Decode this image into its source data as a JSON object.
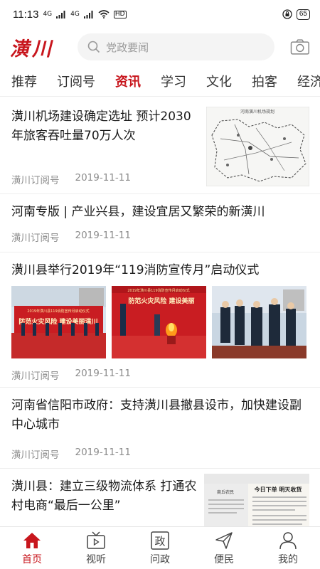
{
  "status_bar": {
    "time": "11:13",
    "network": "4G",
    "network_secondary": "4G",
    "hd_label": "HD",
    "battery": "65"
  },
  "header": {
    "logo": "潢川",
    "search_placeholder": "党政要闻"
  },
  "tabs": [
    {
      "label": "推荐"
    },
    {
      "label": "订阅号"
    },
    {
      "label": "资讯"
    },
    {
      "label": "学习"
    },
    {
      "label": "文化"
    },
    {
      "label": "拍客"
    },
    {
      "label": "经济"
    }
  ],
  "active_tab": "资讯",
  "articles": [
    {
      "title": "潢川机场建设确定选址 预计2030年旅客吞吐量70万人次",
      "source": "潢川订阅号",
      "date": "2019-11-11",
      "thumb_title": "河南潢川机场规划"
    },
    {
      "title": "河南专版 | 产业兴县，建设宜居又繁荣的新潢川",
      "source": "潢川订阅号",
      "date": "2019-11-11"
    },
    {
      "title": "潢川县举行2019年“119消防宣传月”启动仪式",
      "source": "潢川订阅号",
      "date": "2019-11-11",
      "image_banner_1": "2019年潢川县119消防宣传月启动仪式",
      "image_slogan_1": "防范火灾风险 建设美丽潢川",
      "image_banner_2": "2019年潢川县119消防宣传月启动仪式",
      "image_slogan_2": "防范火灾风险 建设美丽"
    },
    {
      "title": "河南省信阳市政府：支持潢川县撤县设市，加快建设副中心城市",
      "source": "潢川订阅号",
      "date": "2019-11-11"
    },
    {
      "title": "潢川县：建立三级物流体系 打通农村电商“最后一公里”",
      "thumb_headline": "今日下单 明天收货",
      "thumb_masthead": "商丘农民"
    }
  ],
  "bottom_nav": [
    {
      "label": "首页",
      "icon": "home-icon"
    },
    {
      "label": "视听",
      "icon": "tv-icon"
    },
    {
      "label": "问政",
      "icon": "zheng-icon",
      "glyph": "政"
    },
    {
      "label": "便民",
      "icon": "send-icon"
    },
    {
      "label": "我的",
      "icon": "user-icon"
    }
  ],
  "colors": {
    "accent": "#c8161d",
    "text": "#1a1a1a",
    "meta": "#8c8c8c",
    "search_bg": "#f4f4f4"
  }
}
